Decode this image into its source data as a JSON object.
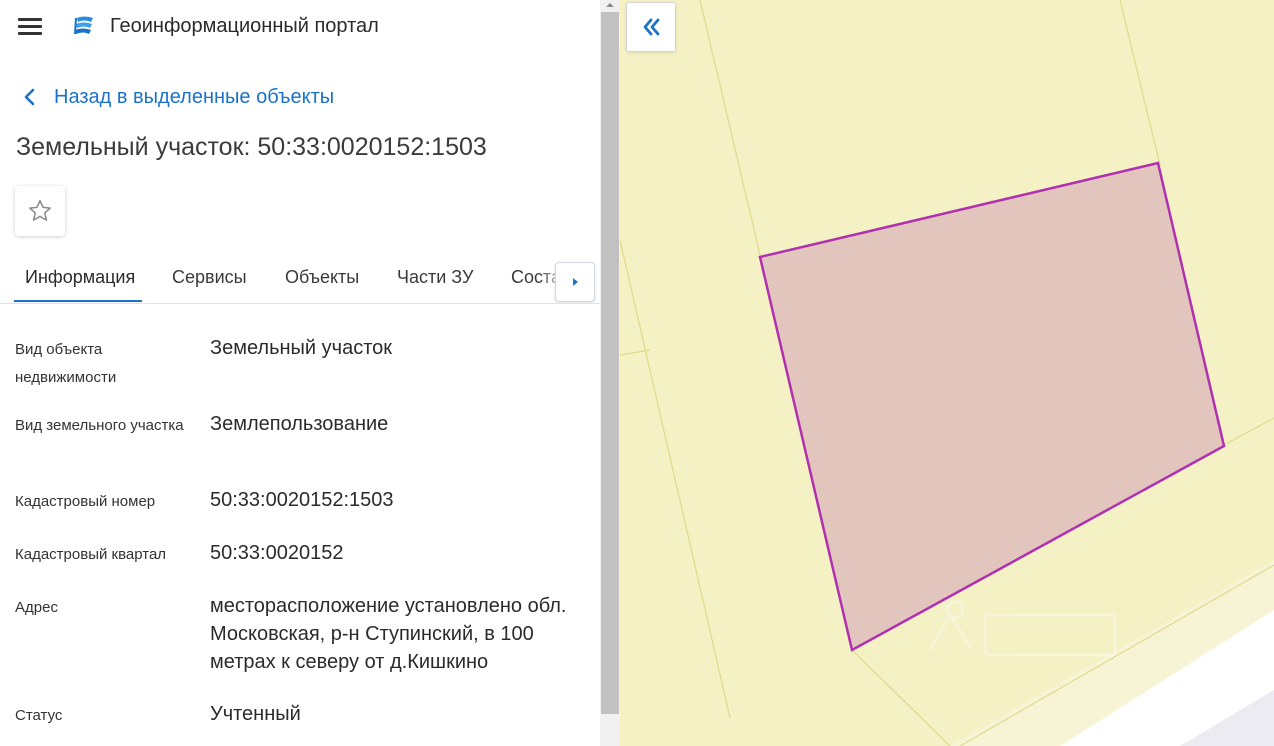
{
  "header": {
    "app_title": "Геоинформационный портал"
  },
  "nav": {
    "back_label": "Назад в выделенные объекты"
  },
  "object": {
    "title": "Земельный участок: 50:33:0020152:1503"
  },
  "tabs": [
    {
      "label": "Информация",
      "active": true
    },
    {
      "label": "Сервисы"
    },
    {
      "label": "Объекты"
    },
    {
      "label": "Части ЗУ"
    },
    {
      "label": "Состав"
    }
  ],
  "info": [
    {
      "label": "Вид объекта недвижимости",
      "value": "Земельный участок"
    },
    {
      "label": "Вид земельного участка",
      "value": "Землепользование"
    },
    {
      "label": "Кадастровый номер",
      "value": "50:33:0020152:1503"
    },
    {
      "label": "Кадастровый квартал",
      "value": "50:33:0020152"
    },
    {
      "label": "Адрес",
      "value": "месторасположение установлено обл. Московская, р-н Ступинский, в 100 метрах к северу от д.Кишкино"
    },
    {
      "label": "Статус",
      "value": "Учтенный"
    }
  ],
  "colors": {
    "accent": "#1a73c9",
    "parcel_stroke": "#b030b0",
    "parcel_fill": "#e2c6bd",
    "map_base": "#f4f1c4"
  },
  "icons": {
    "menu": "hamburger-icon",
    "logo": "portal-logo-icon",
    "back": "chevron-left-icon",
    "favorite": "star-outline-icon",
    "tab_scroll": "caret-right-icon",
    "collapse": "double-chevron-left-icon"
  }
}
